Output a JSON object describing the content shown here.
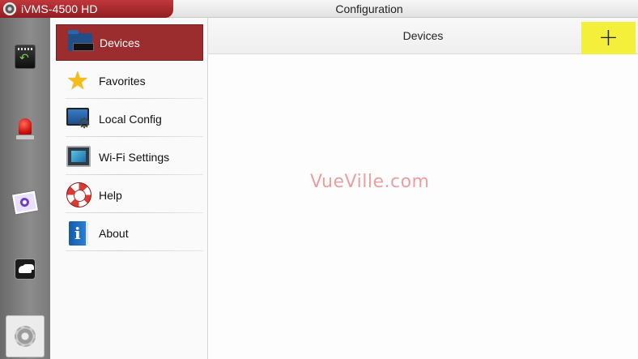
{
  "titlebar": {
    "app_name": "iVMS-4500 HD",
    "window_title": "Configuration"
  },
  "rail": {
    "items": [
      {
        "name": "playback-icon"
      },
      {
        "name": "alarm-icon"
      },
      {
        "name": "picture-icon"
      },
      {
        "name": "cloud-icon"
      },
      {
        "name": "configuration-icon",
        "active": true
      }
    ]
  },
  "menu": {
    "items": [
      {
        "label": "Devices",
        "icon": "devices-icon",
        "active": true
      },
      {
        "label": "Favorites",
        "icon": "star-icon"
      },
      {
        "label": "Local Config",
        "icon": "local-config-icon"
      },
      {
        "label": "Wi-Fi Settings",
        "icon": "wifi-icon"
      },
      {
        "label": "Help",
        "icon": "lifebuoy-icon"
      },
      {
        "label": "About",
        "icon": "info-book-icon"
      }
    ]
  },
  "main": {
    "title": "Devices",
    "add_label": "+",
    "watermark": "VueVille.com"
  },
  "colors": {
    "accent_red": "#9b2d2f",
    "add_button_yellow": "#f3ef3a"
  }
}
